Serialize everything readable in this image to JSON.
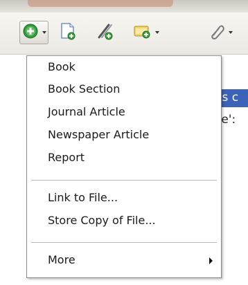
{
  "toolbar": {
    "buttons": [
      {
        "icon": "add-item-icon",
        "has_caret": true
      },
      {
        "icon": "new-note-icon",
        "has_caret": false
      },
      {
        "icon": "attach-link-icon",
        "has_caret": false
      },
      {
        "icon": "new-collection-icon",
        "has_caret": true
      },
      {
        "icon": "paperclip-icon",
        "has_caret": true
      }
    ]
  },
  "content": {
    "selected_text": "es c",
    "text_line": "ce':"
  },
  "menu": {
    "items": [
      {
        "label": "Book"
      },
      {
        "label": "Book Section"
      },
      {
        "label": "Journal Article"
      },
      {
        "label": "Newspaper Article"
      },
      {
        "label": "Report"
      }
    ],
    "file_items": [
      {
        "label": "Link to File..."
      },
      {
        "label": "Store Copy of File..."
      }
    ],
    "more_label": "More"
  },
  "colors": {
    "selection": "#3b63b7",
    "add_icon": "#3aa640",
    "menu_border": "#8a8a8a"
  }
}
